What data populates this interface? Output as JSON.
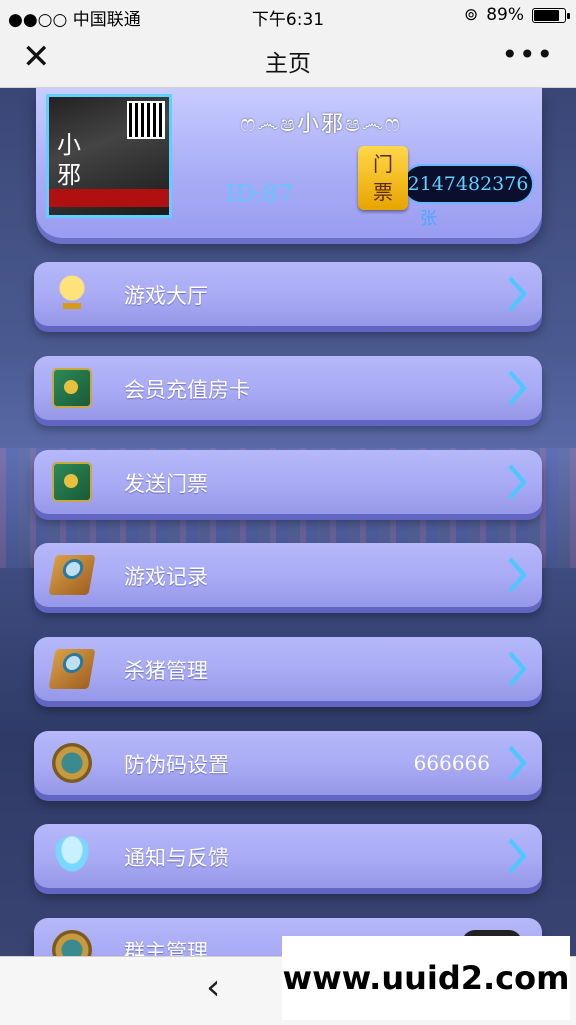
{
  "status_bar": {
    "carrier": "●●○○ 中国联通",
    "time": "下午6:31",
    "battery": "89%",
    "battery_level": 0.89
  },
  "nav": {
    "close_icon": "close-icon",
    "title": "主页",
    "more_icon": "more-icon"
  },
  "profile": {
    "avatar_text": [
      "小",
      "邪"
    ],
    "nickname": "ෆ෴ෂ小邪ෂ෴ෆ",
    "id_text": "ID:87",
    "ticket_label": "门票",
    "ticket_count": "2147482376",
    "ticket_unit": "张"
  },
  "menu": [
    {
      "label": "游戏大厅",
      "icon": "trophy-icon",
      "value": ""
    },
    {
      "label": "会员充值房卡",
      "icon": "book-icon",
      "value": ""
    },
    {
      "label": "发送门票",
      "icon": "book-icon",
      "value": ""
    },
    {
      "label": "游戏记录",
      "icon": "magnifier-icon",
      "value": ""
    },
    {
      "label": "杀猪管理",
      "icon": "magnifier-icon",
      "value": ""
    },
    {
      "label": "防伪码设置",
      "icon": "medal-icon",
      "value": "666666"
    },
    {
      "label": "通知与反馈",
      "icon": "bell-icon",
      "value": ""
    },
    {
      "label": "群主管理",
      "icon": "medal-icon",
      "value": ""
    }
  ],
  "bottom": {
    "back_icon": "back-icon"
  },
  "watermark": "www.uuid2.com",
  "colors": {
    "panel": "#a8aaf4",
    "accent": "#5fd0ff",
    "ticket": "#ffd84a"
  }
}
